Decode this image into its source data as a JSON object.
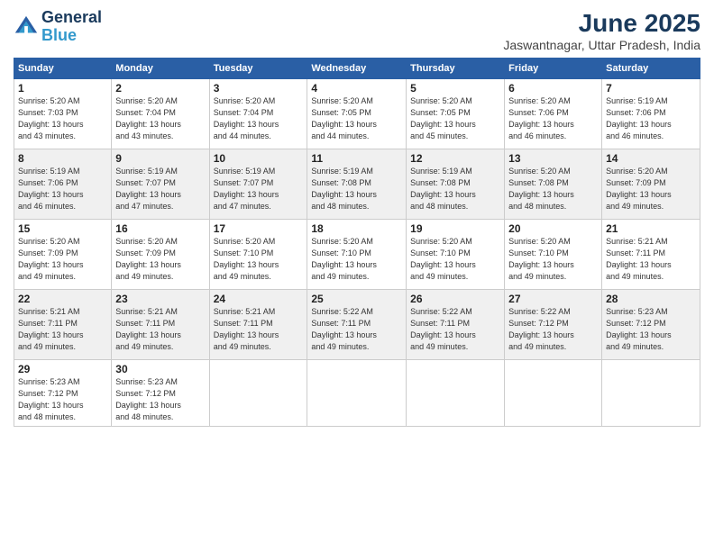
{
  "header": {
    "logo_line1": "General",
    "logo_line2": "Blue",
    "month": "June 2025",
    "location": "Jaswantnagar, Uttar Pradesh, India"
  },
  "columns": [
    "Sunday",
    "Monday",
    "Tuesday",
    "Wednesday",
    "Thursday",
    "Friday",
    "Saturday"
  ],
  "weeks": [
    [
      {
        "day": "1",
        "info": "Sunrise: 5:20 AM\nSunset: 7:03 PM\nDaylight: 13 hours\nand 43 minutes."
      },
      {
        "day": "2",
        "info": "Sunrise: 5:20 AM\nSunset: 7:04 PM\nDaylight: 13 hours\nand 43 minutes."
      },
      {
        "day": "3",
        "info": "Sunrise: 5:20 AM\nSunset: 7:04 PM\nDaylight: 13 hours\nand 44 minutes."
      },
      {
        "day": "4",
        "info": "Sunrise: 5:20 AM\nSunset: 7:05 PM\nDaylight: 13 hours\nand 44 minutes."
      },
      {
        "day": "5",
        "info": "Sunrise: 5:20 AM\nSunset: 7:05 PM\nDaylight: 13 hours\nand 45 minutes."
      },
      {
        "day": "6",
        "info": "Sunrise: 5:20 AM\nSunset: 7:06 PM\nDaylight: 13 hours\nand 46 minutes."
      },
      {
        "day": "7",
        "info": "Sunrise: 5:19 AM\nSunset: 7:06 PM\nDaylight: 13 hours\nand 46 minutes."
      }
    ],
    [
      {
        "day": "8",
        "info": "Sunrise: 5:19 AM\nSunset: 7:06 PM\nDaylight: 13 hours\nand 46 minutes."
      },
      {
        "day": "9",
        "info": "Sunrise: 5:19 AM\nSunset: 7:07 PM\nDaylight: 13 hours\nand 47 minutes."
      },
      {
        "day": "10",
        "info": "Sunrise: 5:19 AM\nSunset: 7:07 PM\nDaylight: 13 hours\nand 47 minutes."
      },
      {
        "day": "11",
        "info": "Sunrise: 5:19 AM\nSunset: 7:08 PM\nDaylight: 13 hours\nand 48 minutes."
      },
      {
        "day": "12",
        "info": "Sunrise: 5:19 AM\nSunset: 7:08 PM\nDaylight: 13 hours\nand 48 minutes."
      },
      {
        "day": "13",
        "info": "Sunrise: 5:20 AM\nSunset: 7:08 PM\nDaylight: 13 hours\nand 48 minutes."
      },
      {
        "day": "14",
        "info": "Sunrise: 5:20 AM\nSunset: 7:09 PM\nDaylight: 13 hours\nand 49 minutes."
      }
    ],
    [
      {
        "day": "15",
        "info": "Sunrise: 5:20 AM\nSunset: 7:09 PM\nDaylight: 13 hours\nand 49 minutes."
      },
      {
        "day": "16",
        "info": "Sunrise: 5:20 AM\nSunset: 7:09 PM\nDaylight: 13 hours\nand 49 minutes."
      },
      {
        "day": "17",
        "info": "Sunrise: 5:20 AM\nSunset: 7:10 PM\nDaylight: 13 hours\nand 49 minutes."
      },
      {
        "day": "18",
        "info": "Sunrise: 5:20 AM\nSunset: 7:10 PM\nDaylight: 13 hours\nand 49 minutes."
      },
      {
        "day": "19",
        "info": "Sunrise: 5:20 AM\nSunset: 7:10 PM\nDaylight: 13 hours\nand 49 minutes."
      },
      {
        "day": "20",
        "info": "Sunrise: 5:20 AM\nSunset: 7:10 PM\nDaylight: 13 hours\nand 49 minutes."
      },
      {
        "day": "21",
        "info": "Sunrise: 5:21 AM\nSunset: 7:11 PM\nDaylight: 13 hours\nand 49 minutes."
      }
    ],
    [
      {
        "day": "22",
        "info": "Sunrise: 5:21 AM\nSunset: 7:11 PM\nDaylight: 13 hours\nand 49 minutes."
      },
      {
        "day": "23",
        "info": "Sunrise: 5:21 AM\nSunset: 7:11 PM\nDaylight: 13 hours\nand 49 minutes."
      },
      {
        "day": "24",
        "info": "Sunrise: 5:21 AM\nSunset: 7:11 PM\nDaylight: 13 hours\nand 49 minutes."
      },
      {
        "day": "25",
        "info": "Sunrise: 5:22 AM\nSunset: 7:11 PM\nDaylight: 13 hours\nand 49 minutes."
      },
      {
        "day": "26",
        "info": "Sunrise: 5:22 AM\nSunset: 7:11 PM\nDaylight: 13 hours\nand 49 minutes."
      },
      {
        "day": "27",
        "info": "Sunrise: 5:22 AM\nSunset: 7:12 PM\nDaylight: 13 hours\nand 49 minutes."
      },
      {
        "day": "28",
        "info": "Sunrise: 5:23 AM\nSunset: 7:12 PM\nDaylight: 13 hours\nand 49 minutes."
      }
    ],
    [
      {
        "day": "29",
        "info": "Sunrise: 5:23 AM\nSunset: 7:12 PM\nDaylight: 13 hours\nand 48 minutes."
      },
      {
        "day": "30",
        "info": "Sunrise: 5:23 AM\nSunset: 7:12 PM\nDaylight: 13 hours\nand 48 minutes."
      },
      {
        "day": "",
        "info": ""
      },
      {
        "day": "",
        "info": ""
      },
      {
        "day": "",
        "info": ""
      },
      {
        "day": "",
        "info": ""
      },
      {
        "day": "",
        "info": ""
      }
    ]
  ]
}
